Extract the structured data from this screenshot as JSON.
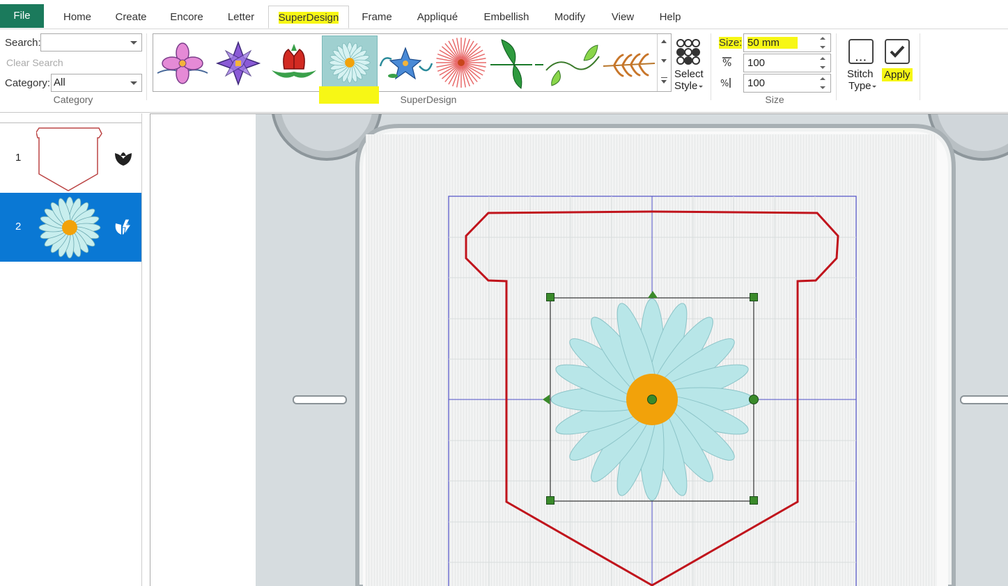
{
  "tabs": {
    "file": "File",
    "items": [
      "Home",
      "Create",
      "Encore",
      "Letter",
      "SuperDesign",
      "Frame",
      "Appliqué",
      "Embellish",
      "Modify",
      "View",
      "Help"
    ],
    "active": "SuperDesign"
  },
  "category_group": {
    "search_label": "Search:",
    "search_value": "",
    "clear_search": "Clear Search",
    "category_label": "Category:",
    "category_value": "All",
    "group_label": "Category"
  },
  "superdesign_group": {
    "group_label": "SuperDesign",
    "select_style": "Select",
    "select_style2": "Style",
    "selected_index": 3
  },
  "size_group": {
    "size_label": "Size:",
    "size_value": "50 mm",
    "width_value": "100",
    "height_value": "100",
    "group_label": "Size"
  },
  "stitch_type": {
    "label1": "Stitch",
    "label2": "Type"
  },
  "apply": {
    "label": "Apply"
  },
  "layers": [
    {
      "number": "1"
    },
    {
      "number": "2",
      "selected": true
    }
  ],
  "colors": {
    "accent": "#0a78d4",
    "file_tab": "#1b7a5c",
    "highlight": "#f7f715",
    "outline_red": "#c0141c",
    "petal": "#b8e6e8",
    "center": "#f2a20a"
  }
}
